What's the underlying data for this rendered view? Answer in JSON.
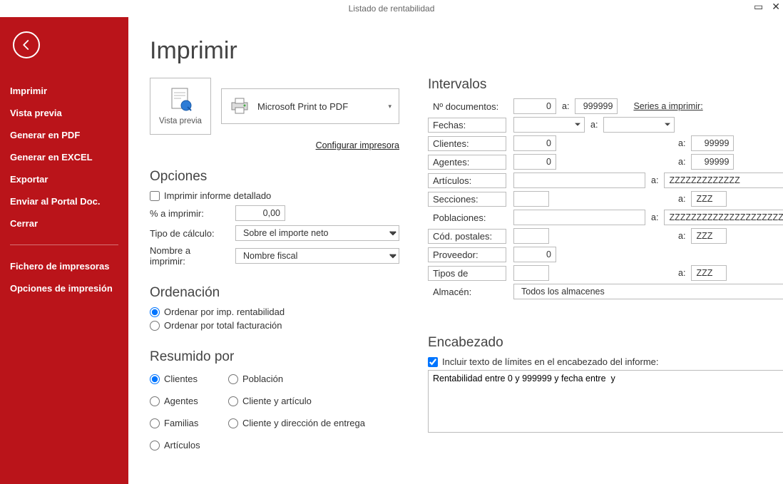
{
  "window": {
    "title": "Listado de rentabilidad"
  },
  "sidebar": {
    "items": [
      "Imprimir",
      "Vista previa",
      "Generar en PDF",
      "Generar en EXCEL",
      "Exportar",
      "Enviar al Portal Doc.",
      "Cerrar"
    ],
    "items2": [
      "Fichero de impresoras",
      "Opciones de impresión"
    ]
  },
  "page": {
    "title": "Imprimir",
    "vista_previa": "Vista previa"
  },
  "printer": {
    "selected": "Microsoft Print to PDF",
    "configure": "Configurar impresora"
  },
  "opciones": {
    "title": "Opciones",
    "detallado_label": "Imprimir informe detallado",
    "detallado_checked": false,
    "porcentaje_label": "% a imprimir:",
    "porcentaje_value": "0,00",
    "tipo_calculo_label": "Tipo de cálculo:",
    "tipo_calculo_value": "Sobre el importe neto",
    "nombre_label": "Nombre a imprimir:",
    "nombre_value": "Nombre fiscal"
  },
  "ordenacion": {
    "title": "Ordenación",
    "opt1": "Ordenar por imp. rentabilidad",
    "opt2": "Ordenar por total facturación",
    "selected": 0
  },
  "resumido": {
    "title": "Resumido por",
    "opts": [
      "Clientes",
      "Agentes",
      "Familias",
      "Artículos",
      "Población",
      "Cliente y artículo",
      "Cliente y dirección de entrega"
    ],
    "selected": 0
  },
  "intervalos": {
    "title": "Intervalos",
    "series_label": "Series a imprimir:",
    "a": "a:",
    "rows": {
      "documentos": {
        "label": "Nº documentos:",
        "from": "0",
        "to": "999999"
      },
      "fechas": {
        "label": "Fechas:",
        "from": "",
        "to": ""
      },
      "clientes": {
        "label": "Clientes:",
        "from": "0",
        "to": "99999"
      },
      "agentes": {
        "label": "Agentes:",
        "from": "0",
        "to": "99999"
      },
      "articulos": {
        "label": "Artículos:",
        "from": "",
        "to": "ZZZZZZZZZZZZZ"
      },
      "secciones": {
        "label": "Secciones:",
        "from": "",
        "to": "ZZZ"
      },
      "poblaciones": {
        "label": "Poblaciones:",
        "from": "",
        "to": "ZZZZZZZZZZZZZZZZZZZZZZZZZZZZZZ"
      },
      "codpostales": {
        "label": "Cód. postales:",
        "from": "",
        "to": "ZZZ"
      },
      "proveedor": {
        "label": "Proveedor:",
        "from": "0"
      },
      "tipos": {
        "label": "Tipos de",
        "from": "",
        "to": "ZZZ"
      },
      "almacen": {
        "label": "Almacén:",
        "value": "Todos los almacenes"
      }
    }
  },
  "encabezado": {
    "title": "Encabezado",
    "checkbox_label": "Incluir texto de límites en el encabezado del informe:",
    "checkbox_checked": true,
    "text": "Rentabilidad entre 0 y 999999 y fecha entre  y"
  }
}
